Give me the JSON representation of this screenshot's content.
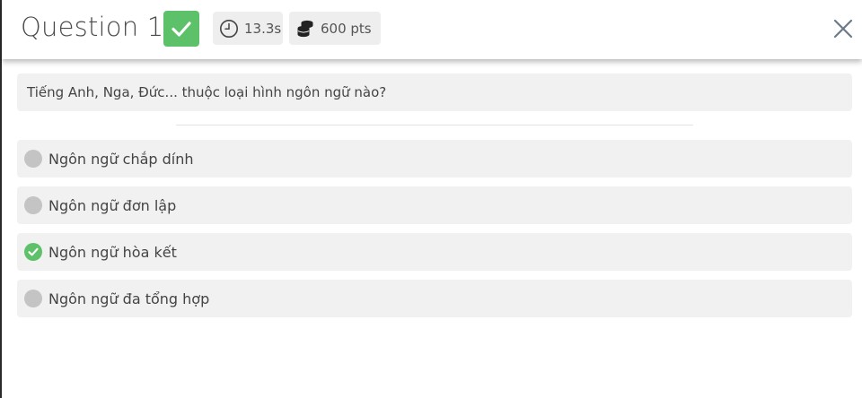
{
  "header": {
    "title": "Question 1",
    "status_icon": "check-icon",
    "status_color": "#5cc168",
    "time_icon": "clock-icon",
    "time": "13.3s",
    "points_icon": "coins-icon",
    "points": "600 pts",
    "close_icon": "close-icon"
  },
  "question": {
    "text": "Tiếng Anh, Nga, Đức... thuộc loại hình ngôn ngữ nào?"
  },
  "options": [
    {
      "label": "Ngôn ngữ chắp dính",
      "state": "unselected"
    },
    {
      "label": "Ngôn ngữ đơn lập",
      "state": "unselected"
    },
    {
      "label": "Ngôn ngữ hòa kết",
      "state": "correct"
    },
    {
      "label": "Ngôn ngữ đa tổng hợp",
      "state": "unselected"
    }
  ],
  "colors": {
    "correct": "#5cc168",
    "neutral_radio": "#c4c4c4",
    "panel": "#f1f1f1"
  }
}
